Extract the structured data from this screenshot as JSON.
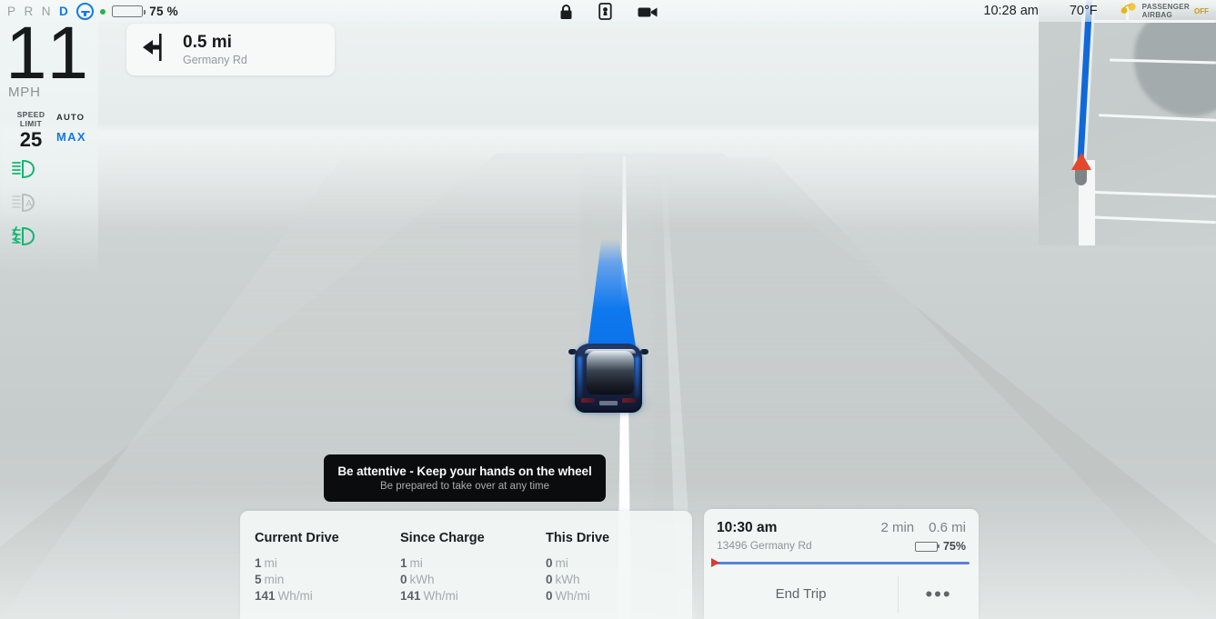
{
  "topbar": {
    "gears": [
      {
        "letter": "P",
        "active": false
      },
      {
        "letter": "R",
        "active": false
      },
      {
        "letter": "N",
        "active": false
      },
      {
        "letter": "D",
        "active": true
      }
    ],
    "autopilot_icon": "steering-wheel-icon",
    "autopilot_status_color": "#1479e4",
    "recording_dot_color": "#2ab24a",
    "battery_percent_label": "75 %",
    "battery_percent_value": 75,
    "status_icons": [
      "lock-icon",
      "phone-key-icon",
      "dashcam-icon"
    ],
    "clock": "10:28 am",
    "temperature": "70°F",
    "airbag": {
      "line1": "PASSENGER",
      "line2": "AIRBAG",
      "state": "OFF",
      "state_color": "#c99a18",
      "icon": "airbag-icon"
    }
  },
  "cluster": {
    "speed": "11",
    "speed_unit": "MPH",
    "speed_limit_label_line1": "SPEED",
    "speed_limit_label_line2": "LIMIT",
    "speed_limit_value": "25",
    "auto_label": "AUTO",
    "auto_mode": "MAX",
    "auto_mode_color": "#1479e4",
    "indicators": [
      {
        "name": "low-beam-headlight-icon",
        "state": "on",
        "color": "#13b472"
      },
      {
        "name": "auto-high-beam-icon",
        "state": "off",
        "color": "#b8bfbe"
      },
      {
        "name": "fog-light-icon",
        "state": "on",
        "color": "#13b472"
      }
    ]
  },
  "navigation": {
    "maneuver_icon": "turn-left-icon",
    "distance": "0.5 mi",
    "street": "Germany Rd"
  },
  "minimap": {
    "route_color": "#1168d8",
    "vehicle_marker": "position-arrow-icon",
    "marker_color": "#e4472c"
  },
  "autopilot_warning": {
    "title": "Be attentive - Keep your hands on the wheel",
    "subtitle": "Be prepared to take over at any time"
  },
  "stats": {
    "columns": [
      {
        "title": "Current Drive",
        "rows": [
          {
            "value": "1",
            "unit": "mi"
          },
          {
            "value": "5",
            "unit": "min"
          },
          {
            "value": "141",
            "unit": "Wh/mi"
          }
        ]
      },
      {
        "title": "Since Charge",
        "rows": [
          {
            "value": "1",
            "unit": "mi"
          },
          {
            "value": "0",
            "unit": "kWh"
          },
          {
            "value": "141",
            "unit": "Wh/mi"
          }
        ]
      },
      {
        "title": "This Drive",
        "rows": [
          {
            "value": "0",
            "unit": "mi"
          },
          {
            "value": "0",
            "unit": "kWh"
          },
          {
            "value": "0",
            "unit": "Wh/mi"
          }
        ]
      }
    ]
  },
  "trip": {
    "eta": "10:30 am",
    "destination": "13496 Germany Rd",
    "duration": "2 min",
    "distance": "0.6 mi",
    "arrival_battery": "75%",
    "arrival_battery_value": 75,
    "progress_percent": 2,
    "end_trip_label": "End Trip",
    "more_label": "•••"
  }
}
